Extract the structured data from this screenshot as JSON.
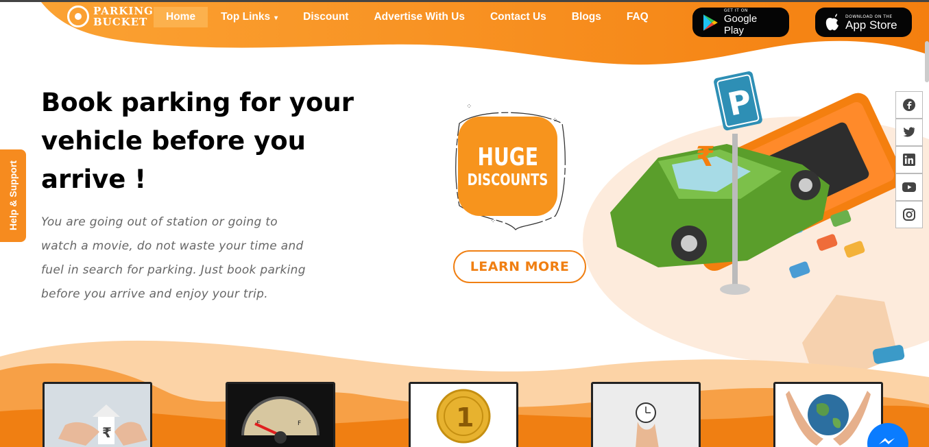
{
  "brand": {
    "line1": "PARKING",
    "line2": "BUCKET"
  },
  "nav": {
    "items": [
      {
        "label": "Home",
        "active": true
      },
      {
        "label": "Top Links",
        "caret": "▾"
      },
      {
        "label": "Discount"
      },
      {
        "label": "Advertise With Us"
      },
      {
        "label": "Contact Us"
      },
      {
        "label": "Blogs"
      },
      {
        "label": "FAQ"
      }
    ]
  },
  "stores": {
    "google": {
      "sub": "GET IT ON",
      "main": "Google Play"
    },
    "apple": {
      "sub": "DOWNLOAD ON THE",
      "main": "App Store"
    }
  },
  "hero": {
    "title": "Book parking for your vehicle before you arrive !",
    "description": "You are going out of station or going to watch a movie, do not waste your time and fuel in search for parking. Just book parking before you arrive and enjoy your trip."
  },
  "help_tab": "Help & Support",
  "promo": {
    "line1": "HUGE",
    "line2": "DISCOUNTS",
    "button": "LEARN MORE"
  },
  "illustration": {
    "sign_letter": "P",
    "currency_symbol": "₹"
  },
  "social": [
    "facebook-icon",
    "twitter-icon",
    "linkedin-icon",
    "youtube-icon",
    "instagram-icon"
  ],
  "colors": {
    "accent": "#f68b1f",
    "header": "#f7901e",
    "light_orange": "#fcd3a6"
  }
}
